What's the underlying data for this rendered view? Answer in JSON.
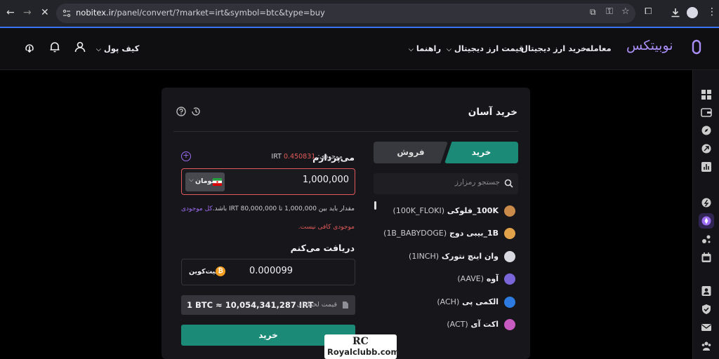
{
  "browser": {
    "url_host": "nobitex.ir",
    "url_path": "/panel/convert/?market=irt&symbol=btc&type=buy"
  },
  "header": {
    "logo_text": "نوبیتکس",
    "nav": [
      {
        "label": "معامله"
      },
      {
        "label": "خرید ارز دیجیتال"
      },
      {
        "label": "قیمت ارز دیجیتال"
      },
      {
        "label": "راهنما"
      }
    ],
    "wallet_label": "کیف پول"
  },
  "card": {
    "title": "خرید آسان",
    "tabs": {
      "buy": "خرید",
      "sell": "فروش"
    },
    "search_placeholder": "جستجو رمزارز",
    "coins": [
      {
        "name": "100K_فلوکی",
        "symbol": "(100K_FLOKI)",
        "color": "#c98a4a"
      },
      {
        "name": "1B_بیبی دوج",
        "symbol": "(1B_BABYDOGE)",
        "color": "#e2a24a"
      },
      {
        "name": "وان اینچ نتورک",
        "symbol": "(1INCH)",
        "color": "#d8d8e0"
      },
      {
        "name": "آوه",
        "symbol": "(AAVE)",
        "color": "#7a66d8"
      },
      {
        "name": "الکمی پی",
        "symbol": "(ACH)",
        "color": "#2d7be0"
      },
      {
        "name": "اکت آی",
        "symbol": "(ACT)",
        "color": "#c75bc2"
      }
    ]
  },
  "pay": {
    "title": "می‌پردازم",
    "balance_label": "موجودی:",
    "balance_value": "0.450831",
    "balance_unit": "IRT",
    "amount": "1,000,000",
    "currency": "تومان",
    "range_message": "مقدار باید بین 1,000,000 تا 80,000,000 IRT باشد.",
    "all_balance": "کل موجودی",
    "error_message": "موجودی کافی نیست."
  },
  "receive": {
    "title": "دریافت می‌کنم",
    "amount": "0.000099",
    "currency": "بیت‌کوین"
  },
  "rate": {
    "label": "قیمت لحظه‌ای",
    "value": "1 BTC ≈ 10,054,341,287 IRT"
  },
  "buy_button": "خرید",
  "watermark": {
    "logo": "RC",
    "text": "Royalclubb.com"
  },
  "colors": {
    "accent_green": "#1b8b78",
    "accent_purple": "#9c6cf2",
    "error_red": "#e25a5a"
  }
}
